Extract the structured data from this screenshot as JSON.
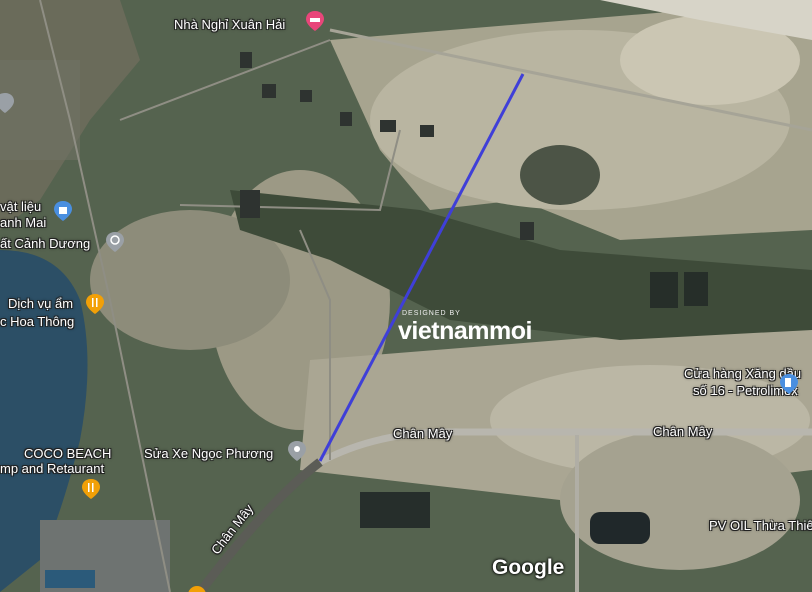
{
  "labels": {
    "nha_nghi": "Nhà Nghỉ Xuân Hải",
    "vat_lieu": "vật liệu",
    "anh_mai": "anh Mai",
    "canh_duong": "ất Cảnh Dương",
    "dich_vu": "Dịch vụ ẩm",
    "hoa_thong": "c Hoa Thông",
    "coco": "COCO BEACH",
    "camp": "mp and Retaurant",
    "sua_xe": "Sửa Xe Ngọc Phương",
    "chan_may_1": "Chân Mây",
    "chan_may_2": "Chân Mây",
    "chan_may_3": "Chân Mây",
    "cua_hang": "Cửa hàng Xăng dầu",
    "so16": "số 16 - Petrolimex",
    "pv_oil": "PV OIL Thừa Thiên",
    "wm_small": "DESIGNED BY",
    "wm_main": "vietnammoi",
    "google": "Google"
  },
  "icons": {
    "hotel": "hotel-pin-icon",
    "shop": "shopping-bag-pin-icon",
    "wheel": "ship-wheel-pin-icon",
    "food": "restaurant-pin-icon",
    "generic": "map-pin-icon",
    "fuel": "gas-station-pin-icon"
  },
  "colors": {
    "route": "#3f3fd8",
    "pink_pin": "#e8467a",
    "blue_pin": "#4a8fe0",
    "orange_pin": "#f2a007",
    "grey_pin": "#9aa0a6"
  }
}
